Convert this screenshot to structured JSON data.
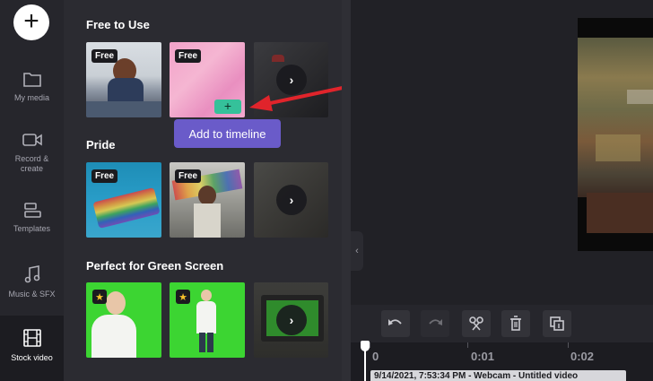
{
  "nav": {
    "add_symbol": "+",
    "items": [
      {
        "label": "My media",
        "icon": "folder-icon"
      },
      {
        "label": "Record & create",
        "icon": "camera-icon"
      },
      {
        "label": "Templates",
        "icon": "templates-icon"
      },
      {
        "label": "Music & SFX",
        "icon": "music-icon"
      },
      {
        "label": "Stock video",
        "icon": "film-icon"
      }
    ]
  },
  "sections": [
    {
      "title": "Free to Use",
      "badges": [
        "Free",
        "Free"
      ]
    },
    {
      "title": "Pride",
      "badges": [
        "Free",
        "Free"
      ]
    },
    {
      "title": "Perfect for Green Screen",
      "badges": [
        "star",
        "star"
      ]
    }
  ],
  "tooltip": "Add to timeline",
  "add_symbol": "+",
  "more_symbol": "›",
  "collapse_symbol": "‹",
  "timeline": {
    "ticks": [
      "0",
      "0:01",
      "0:02"
    ],
    "clip_label": "9/14/2021, 7:53:34 PM - Webcam - Untitled video"
  },
  "colors": {
    "accent_purple": "#6a5bc9",
    "add_green": "#35c19a",
    "arrow_red": "#e0242b"
  }
}
